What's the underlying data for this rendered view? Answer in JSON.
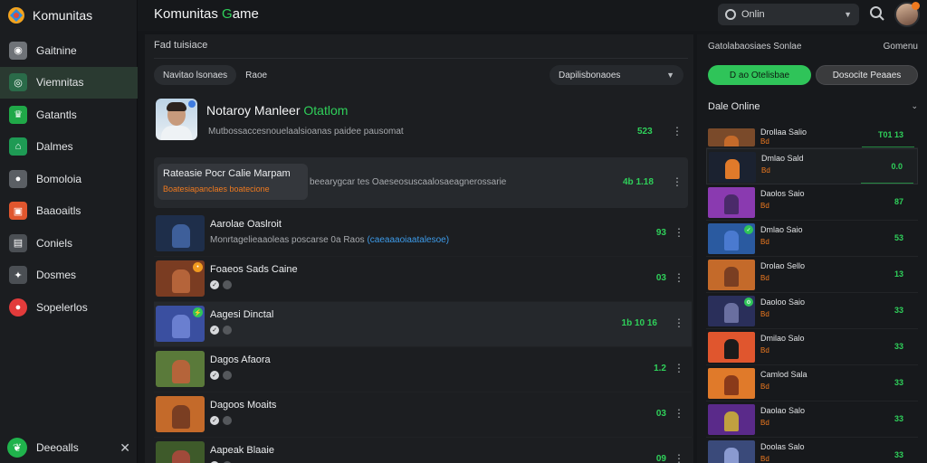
{
  "brand": {
    "title": "Komunitas"
  },
  "sidebar": {
    "items": [
      {
        "label": "Gaitnine",
        "icon": "gamepad-icon",
        "color": "#6f7378"
      },
      {
        "label": "Viemnitas",
        "icon": "controller-icon",
        "color": "#2a6b49",
        "active": true
      },
      {
        "label": "Gatantls",
        "icon": "trophy-icon",
        "color": "#20a848"
      },
      {
        "label": "Dalmes",
        "icon": "home-icon",
        "color": "#1e9a54"
      },
      {
        "label": "Bomoloia",
        "icon": "joystick-icon",
        "color": "#5b5f64"
      },
      {
        "label": "Baaoaitls",
        "icon": "puzzle-icon",
        "color": "#e0562e"
      },
      {
        "label": "Coniels",
        "icon": "chart-icon",
        "color": "#4b4f54"
      },
      {
        "label": "Dosmes",
        "icon": "star-icon",
        "color": "#4b4f54"
      },
      {
        "label": "Sopelerlos",
        "icon": "fire-icon",
        "color": "#e23b3b"
      }
    ],
    "footer": {
      "label": "Deeoalls",
      "icon": "leaf-icon",
      "close": "✕"
    }
  },
  "topbar": {
    "title_main": "Komunitas ",
    "title_accent": "G",
    "title_rest": "ame",
    "search_value": "Onlin",
    "search_icon": "search-icon"
  },
  "main": {
    "header": "Fad tuisiace",
    "chips": [
      "Navitao lsonaes",
      "Raoe"
    ],
    "dropdown": "Dapilisbonaoes",
    "featured": {
      "title_main": "Notaroy Manleer ",
      "title_accent": "Otatlom",
      "sub": "Mutbossaccesnouelaalsioanas paidee pausomat",
      "count": "523"
    },
    "tooltip": {
      "title": "Rateasie Pocr Calie Marpam",
      "sub": "Boatesiapanclaes boatecione",
      "desc": "beearygcar tes Oaeseosuscaalosaeagnerossarie",
      "count": "4b 1.18"
    },
    "games": [
      {
        "name": "Aarolae Oaslroit",
        "desc": "Monrtagelieaaoleas poscarse 0a Raos",
        "link": "(caeaaaoiaatalesoe)",
        "score": "93",
        "thumb": "#1e2e4a",
        "fig": "#3e5f9a",
        "badge": "",
        "badgeColor": ""
      },
      {
        "name": "Foaeos Sads Caine",
        "desc": "",
        "score": "03",
        "thumb": "#7a3c22",
        "fig": "#b5643a",
        "badge": "•",
        "badgeColor": "#f09a1f"
      },
      {
        "name": "Aagesi Dinctal",
        "desc": "",
        "score": "1b 10 16",
        "thumb": "#3a4fa0",
        "fig": "#6a7fd0",
        "badge": "⚡",
        "badgeColor": "#2fc459",
        "hl": true
      },
      {
        "name": "Dagos Afaora",
        "desc": "",
        "score": "1.2",
        "thumb": "#5a7a3a",
        "fig": "#b5643a",
        "badge": "",
        "badgeColor": ""
      },
      {
        "name": "Dagoos Moaits",
        "desc": "",
        "score": "03",
        "thumb": "#c46a2a",
        "fig": "#7a3e22",
        "badge": "",
        "badgeColor": ""
      },
      {
        "name": "Aapeak Blaaie",
        "desc": "",
        "score": "09",
        "thumb": "#3e5a2a",
        "fig": "#a04a3a",
        "badge": "",
        "badgeColor": ""
      }
    ]
  },
  "rpanel": {
    "head_left": "Gatolabaosiaes Sonlae",
    "head_right": "Gomenu",
    "btn_green": "D ao Otelisbae",
    "btn_gray": "Dosocite Peaaes",
    "section": "Dale Online",
    "rows": [
      {
        "name": "Drollaa Salio",
        "sub": "Bd",
        "val": "T01 13",
        "thumb": "#7a4a2a",
        "fig": "#c46a2a",
        "badge": ""
      },
      {
        "name": "Dmlao Sald",
        "sub": "Bd",
        "val": "0.0",
        "thumb": "#1b2230",
        "fig": "#e07a2a",
        "badge": "",
        "sel": true
      },
      {
        "name": "Daolos Saio",
        "sub": "Bd",
        "val": "87",
        "thumb": "#8a3ab0",
        "fig": "#4a2a6a",
        "badge": ""
      },
      {
        "name": "Dmlao Saio",
        "sub": "Bd",
        "val": "53",
        "thumb": "#2a5aa0",
        "fig": "#4a7ad0",
        "badge": "✓",
        "badgeColor": "#2fc459"
      },
      {
        "name": "Drolao Sello",
        "sub": "Bd",
        "val": "13",
        "thumb": "#c46a2a",
        "fig": "#7a3e22",
        "badge": ""
      },
      {
        "name": "Daoloo Saio",
        "sub": "Bd",
        "val": "33",
        "thumb": "#2a2f5a",
        "fig": "#6a6fa0",
        "badge": "⚙",
        "badgeColor": "#2fc459"
      },
      {
        "name": "Dmilao Salo",
        "sub": "Bd",
        "val": "33",
        "thumb": "#e0562e",
        "fig": "#1b1b1b",
        "badge": ""
      },
      {
        "name": "Camlod Sala",
        "sub": "Bd",
        "val": "33",
        "thumb": "#e07a2a",
        "fig": "#8a3a1a",
        "badge": ""
      },
      {
        "name": "Daolao Salo",
        "sub": "Bd",
        "val": "33",
        "thumb": "#5a2a8a",
        "fig": "#c0a040",
        "badge": ""
      },
      {
        "name": "Doolas Salo",
        "sub": "Bd",
        "val": "33",
        "thumb": "#3a4a7a",
        "fig": "#8a9ad0",
        "badge": ""
      }
    ]
  }
}
